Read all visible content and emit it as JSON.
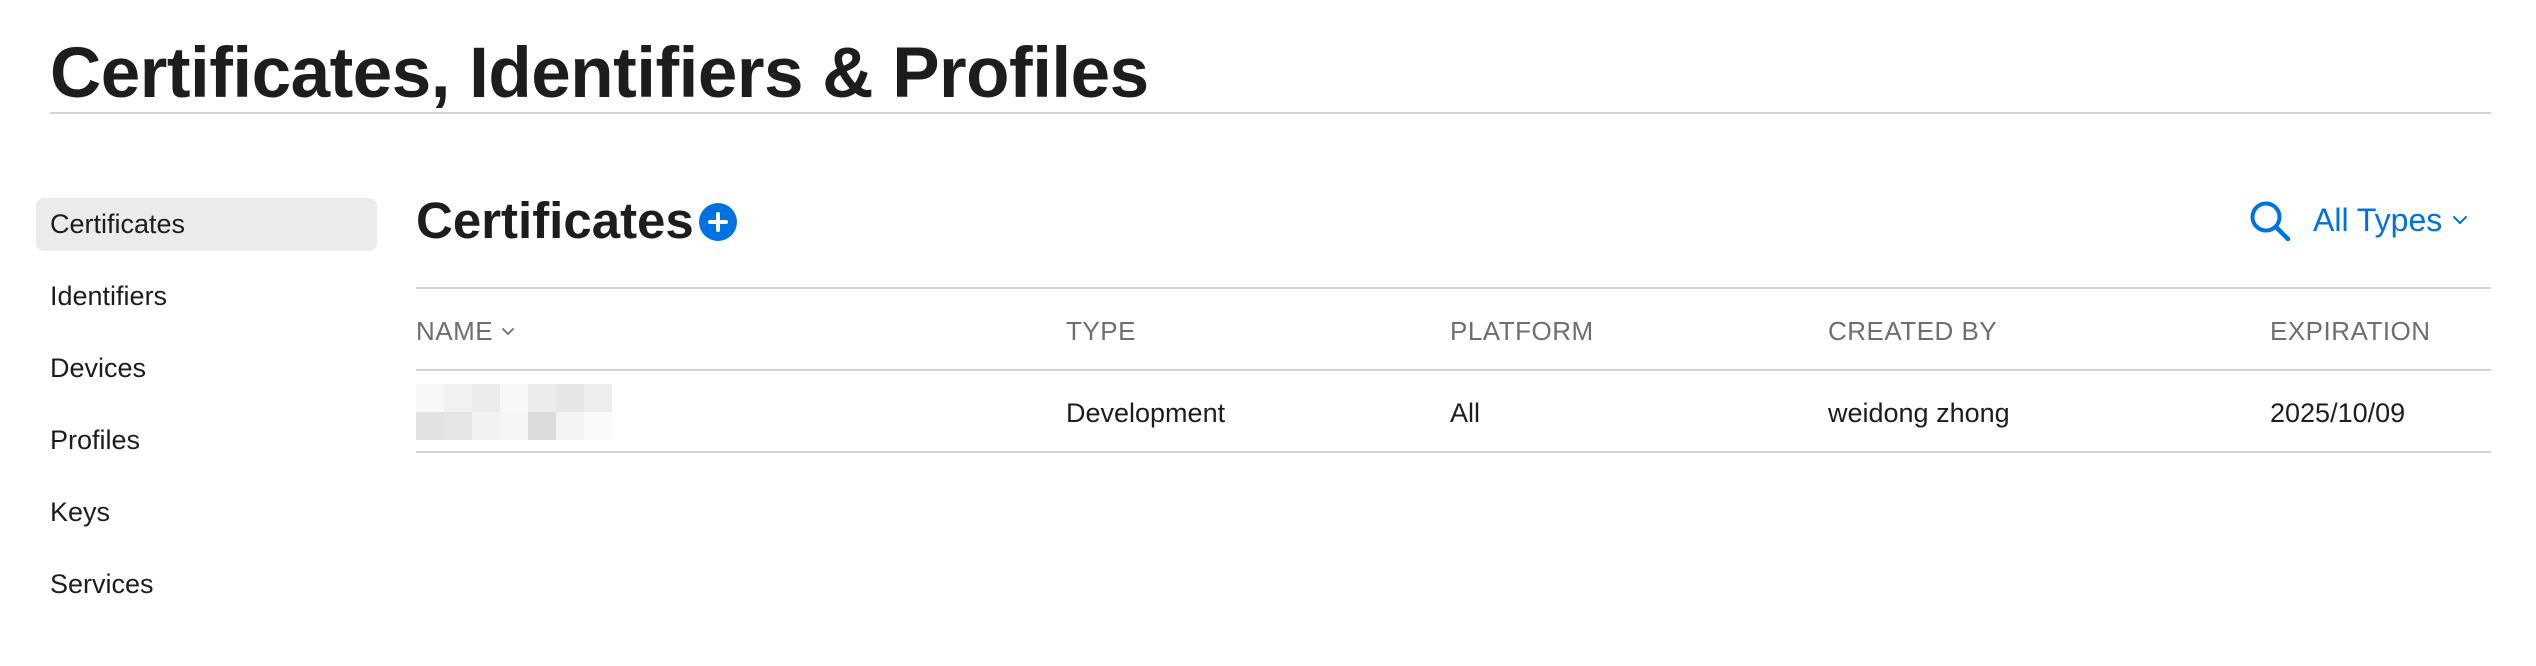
{
  "page": {
    "title": "Certificates, Identifiers & Profiles"
  },
  "sidebar": {
    "items": [
      {
        "label": "Certificates",
        "active": true
      },
      {
        "label": "Identifiers",
        "active": false
      },
      {
        "label": "Devices",
        "active": false
      },
      {
        "label": "Profiles",
        "active": false
      },
      {
        "label": "Keys",
        "active": false
      },
      {
        "label": "Services",
        "active": false
      }
    ]
  },
  "main": {
    "title": "Certificates",
    "add_icon": "plus-circle-icon",
    "search_icon": "search-icon",
    "filter": {
      "selected": "All Types",
      "icon": "chevron-down-icon"
    }
  },
  "table": {
    "columns": [
      "NAME",
      "TYPE",
      "PLATFORM",
      "CREATED BY",
      "EXPIRATION"
    ],
    "sort_column": "NAME",
    "rows": [
      {
        "name_redacted": true,
        "type": "Development",
        "platform": "All",
        "created_by": "weidong zhong",
        "expiration": "2025/10/09"
      }
    ]
  },
  "colors": {
    "accent": "#0071e3",
    "text": "#1d1d1f",
    "secondary_text": "#6e6e73",
    "divider": "#d2d2d7",
    "active_nav_bg": "#ebebeb"
  }
}
